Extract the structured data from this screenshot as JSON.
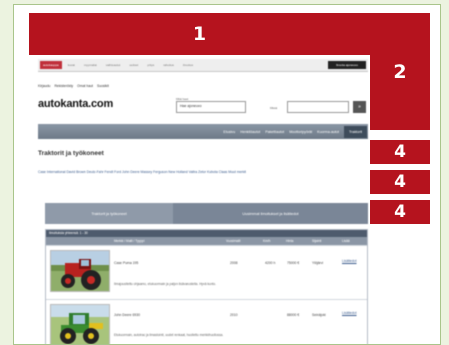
{
  "ads": {
    "ad1": "1",
    "ad2": "2",
    "ad4a": "4",
    "ad4b": "4",
    "ad4c": "4"
  },
  "top_nav": {
    "items": [
      "autokauppa",
      "kuvat",
      "myymalat",
      "vaihtoautot",
      "uutiset",
      "yritys",
      "rahoitus",
      "ilmoitus"
    ],
    "button": "Ilmoita ajoneuvo"
  },
  "user_links": [
    "Kirjaudu",
    "Rekisteröidy",
    "Omat haut",
    "Suosikit"
  ],
  "logo": "autokanta.com",
  "search": {
    "label": "Mitä haet",
    "value": "Hae ajoneuvo",
    "where_label": "Mistä",
    "go": "»"
  },
  "main_nav": [
    "Etusivu",
    "Henkilöautot",
    "Pakettiautot",
    "Moottoripyörät",
    "Kuorma-autot",
    "Traktorit"
  ],
  "content": {
    "title": "Traktorit ja työkoneet",
    "categories": "Case International  David Brown  Deutz-Fahr  Fendt  Ford  John Deere  Massey Ferguson  New Holland  Valtra  Zetor  Kubota  Claas  Muut merkit"
  },
  "tabs": [
    "Traktorit ja työkoneet",
    "Uusimmat ilmoitukset ja lisätiedot"
  ],
  "table": {
    "header": "Ilmoituksia yhteensä: 1 - 30",
    "columns": [
      "Merkki / Malli / Tyyppi",
      "Vuosimalli",
      "Km/h",
      "Hinta",
      "Sijainti",
      "Lisää"
    ],
    "rows": [
      {
        "title": "Case Puma 195",
        "year": "2008",
        "hours": "4200 h",
        "price": "75000 €",
        "location": "Ylöjärvi",
        "more": "Lisätiedot",
        "desc": "Ilmajousitettu ohjaamo, etukuormain ja paljon lisävarusteita. Hyvä kunto."
      },
      {
        "title": "John Deere 6930",
        "year": "2010",
        "hours": "",
        "price": "88000 €",
        "location": "Seinäjoki",
        "more": "Lisätiedot",
        "desc": "Etukuormain, autotrac ja ilmastointi, uudet renkaat, huollettu merkkihuollossa."
      }
    ]
  },
  "colors": {
    "ad": "#b5131e",
    "nav": "#7a8697",
    "frame": "#a9c58b"
  }
}
